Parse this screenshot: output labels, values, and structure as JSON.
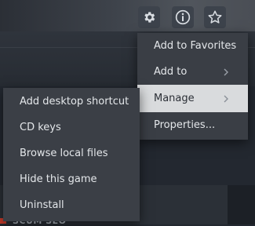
{
  "window": {
    "peek_text": "SCUM SEO"
  },
  "toolbar": {
    "icons": [
      "gear-icon",
      "info-icon",
      "star-icon"
    ],
    "colors": {
      "button_bg": "#3d434c",
      "icon": "#d9dde2"
    }
  },
  "context_menu": {
    "items": [
      {
        "label": "Add to Favorites",
        "has_submenu": false
      },
      {
        "label": "Add to",
        "has_submenu": true
      },
      {
        "label": "Manage",
        "has_submenu": true,
        "highlighted": true
      },
      {
        "label": "Properties...",
        "has_submenu": false
      }
    ]
  },
  "submenu": {
    "items": [
      {
        "label": "Add desktop shortcut"
      },
      {
        "label": "CD keys"
      },
      {
        "label": "Browse local files"
      },
      {
        "label": "Hide this game"
      },
      {
        "label": "Uninstall"
      }
    ]
  },
  "colors": {
    "menu_bg": "#3a3e45",
    "highlight_bg": "#d9dbdd",
    "text": "#e4e7ea"
  }
}
